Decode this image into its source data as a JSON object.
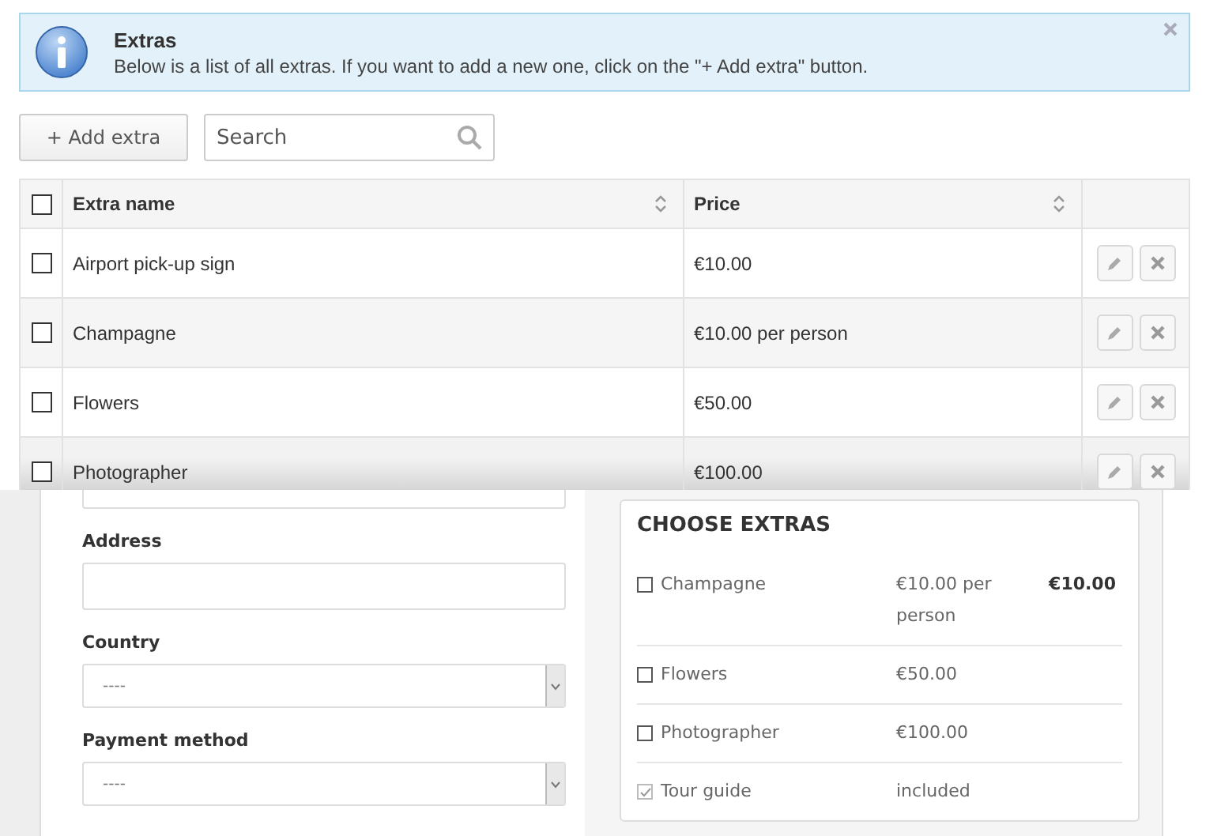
{
  "alert": {
    "title": "Extras",
    "message": "Below is a list of all extras. If you want to add a new one, click on the \"+ Add extra\" button."
  },
  "toolbar": {
    "add_button": "+ Add extra",
    "search": {
      "placeholder": "Search"
    }
  },
  "table": {
    "select_all": {
      "checked": false
    },
    "columns": [
      "Extra name",
      "Price"
    ],
    "rows": [
      {
        "name": "Airport pick-up sign",
        "price": "€10.00",
        "checked": false
      },
      {
        "name": "Champagne",
        "price": "€10.00 per person",
        "checked": false
      },
      {
        "name": "Flowers",
        "price": "€50.00",
        "checked": false
      },
      {
        "name": "Photographer",
        "price": "€100.00",
        "checked": false
      }
    ]
  },
  "form": {
    "fields": [
      {
        "kind": "input"
      },
      {
        "kind": "input",
        "label": "Address"
      },
      {
        "kind": "select",
        "label": "Country",
        "value": "----"
      },
      {
        "kind": "select",
        "label": "Payment method",
        "value": "----"
      }
    ]
  },
  "choose_extras": {
    "title": "CHOOSE EXTRAS",
    "items": [
      {
        "name": "Champagne",
        "price": "€10.00 per person",
        "total": "€10.00",
        "checked": false,
        "disabled": false
      },
      {
        "name": "Flowers",
        "price": "€50.00",
        "checked": false,
        "disabled": false
      },
      {
        "name": "Photographer",
        "price": "€100.00",
        "checked": false,
        "disabled": false
      },
      {
        "name": "Tour guide",
        "price": "included",
        "checked": true,
        "disabled": true
      }
    ]
  }
}
